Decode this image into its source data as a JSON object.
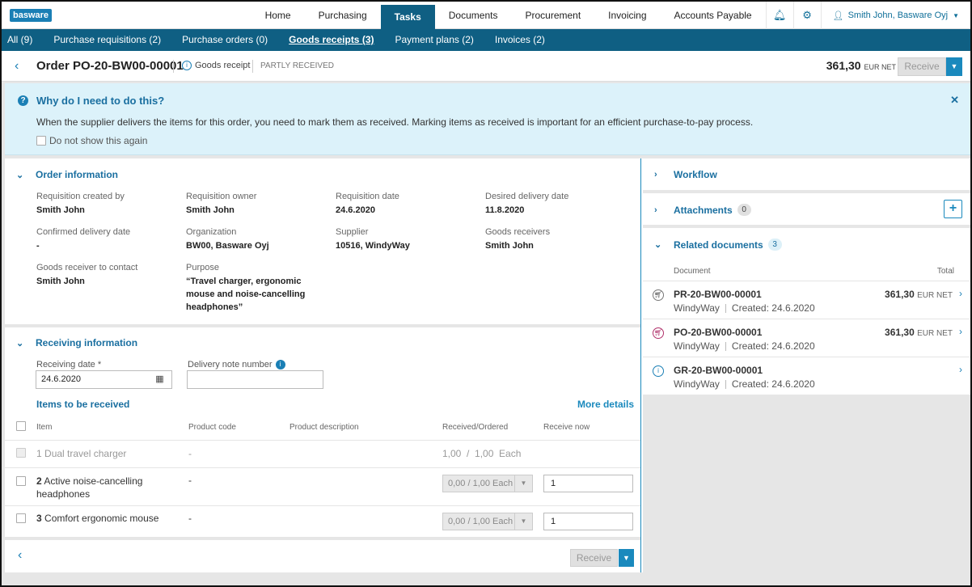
{
  "topbar": {
    "logo": "basware",
    "nav": [
      "Home",
      "Purchasing",
      "Tasks",
      "Documents",
      "Procurement",
      "Invoicing",
      "Accounts Payable"
    ],
    "active": "Tasks",
    "user": "Smith John, Basware Oyj"
  },
  "tabs": [
    {
      "label": "All (9)"
    },
    {
      "label": "Purchase requisitions (2)"
    },
    {
      "label": "Purchase orders (0)"
    },
    {
      "label": "Goods receipts (3)",
      "active": true
    },
    {
      "label": "Payment plans (2)"
    },
    {
      "label": "Invoices (2)"
    }
  ],
  "header": {
    "title": "Order PO-20-BW00-00001",
    "doc_type": "Goods receipt",
    "status": "PARTLY RECEIVED",
    "amount": "361,30",
    "currency": "EUR NET",
    "receive": "Receive"
  },
  "info": {
    "title": "Why do I need to do this?",
    "message": "When the supplier delivers the items for this order, you need to mark them as received. Marking items as received is important for an efficient purchase-to-pay process.",
    "checkbox": "Do not show this again"
  },
  "order_info": {
    "title": "Order information",
    "fields": [
      {
        "label": "Requisition created by",
        "value": "Smith John"
      },
      {
        "label": "Requisition owner",
        "value": "Smith John"
      },
      {
        "label": "Requisition date",
        "value": "24.6.2020"
      },
      {
        "label": "Desired delivery date",
        "value": "11.8.2020"
      },
      {
        "label": "Confirmed delivery date",
        "value": "-"
      },
      {
        "label": "Organization",
        "value": "BW00, Basware Oyj"
      },
      {
        "label": "Supplier",
        "value": "10516, WindyWay"
      },
      {
        "label": "Goods receivers",
        "value": "Smith John"
      },
      {
        "label": "Goods receiver to contact",
        "value": "Smith John"
      },
      {
        "label": "Purpose",
        "value": "“Travel charger, ergonomic mouse and noise-cancelling headphones”"
      }
    ]
  },
  "receiving": {
    "title": "Receiving information",
    "date_label": "Receiving date *",
    "date_value": "24.6.2020",
    "note_label": "Delivery note number",
    "items_title": "Items to be received",
    "more_details": "More details",
    "columns": [
      "Item",
      "Product code",
      "Product description",
      "Received/Ordered",
      "Receive now"
    ],
    "items": [
      {
        "num": "1",
        "name": "Dual travel charger",
        "code": "-",
        "received": "1,00  /  1,00  Each",
        "now": ""
      },
      {
        "num": "2",
        "name": "Active noise-cancelling headphones",
        "code": "-",
        "received": "0,00 / 1,00 Each",
        "now": "1"
      },
      {
        "num": "3",
        "name": "Comfort ergonomic mouse",
        "code": "-",
        "received": "0,00 / 1,00 Each",
        "now": "1"
      }
    ],
    "receive": "Receive"
  },
  "right": {
    "workflow": "Workflow",
    "attachments": "Attachments",
    "attachments_count": "0",
    "related": "Related documents",
    "related_count": "3",
    "col_doc": "Document",
    "col_total": "Total",
    "docs": [
      {
        "id": "PR-20-BW00-00001",
        "supplier": "WindyWay",
        "created": "Created: 24.6.2020",
        "total": "361,30",
        "cur": "EUR NET",
        "icon": "cart-icon"
      },
      {
        "id": "PO-20-BW00-00001",
        "supplier": "WindyWay",
        "created": "Created: 24.6.2020",
        "total": "361,30",
        "cur": "EUR NET",
        "icon": "purchase-order-icon"
      },
      {
        "id": "GR-20-BW00-00001",
        "supplier": "WindyWay",
        "created": "Created: 24.6.2020",
        "total": "",
        "cur": "",
        "icon": "goods-receipt-icon"
      }
    ]
  }
}
